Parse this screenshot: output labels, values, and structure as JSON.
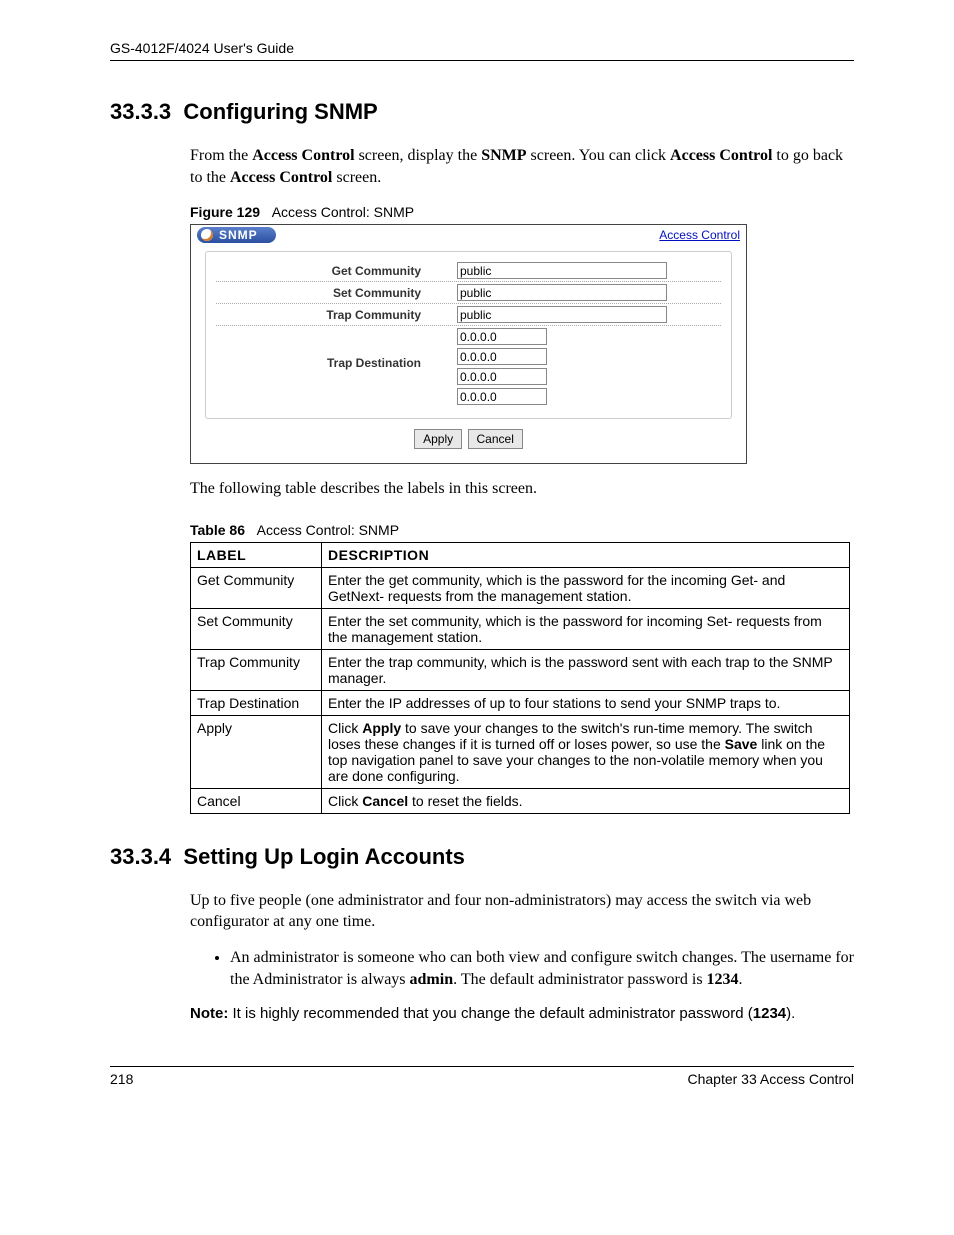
{
  "header": {
    "guide": "GS-4012F/4024 User's Guide"
  },
  "section1": {
    "number": "33.3.3",
    "title": "Configuring SNMP",
    "intro_a": "From the ",
    "intro_b": "Access Control",
    "intro_c": " screen, display the ",
    "intro_d": "SNMP",
    "intro_e": " screen.  You can click ",
    "intro_f": "Access Control",
    "intro_g": " to go back to the ",
    "intro_h": "Access Control",
    "intro_i": " screen."
  },
  "figure": {
    "label": "Figure 129",
    "caption": "Access Control: SNMP",
    "tab": "SNMP",
    "link": "Access Control",
    "rows": {
      "get": {
        "label": "Get Community",
        "value": "public"
      },
      "set": {
        "label": "Set Community",
        "value": "public"
      },
      "trap": {
        "label": "Trap Community",
        "value": "public"
      },
      "dest": {
        "label": "Trap Destination",
        "v1": "0.0.0.0",
        "v2": "0.0.0.0",
        "v3": "0.0.0.0",
        "v4": "0.0.0.0"
      }
    },
    "buttons": {
      "apply": "Apply",
      "cancel": "Cancel"
    }
  },
  "after_figure": "The following table describes the labels in this screen.",
  "table_caption": {
    "label": "Table 86",
    "text": "Access Control: SNMP"
  },
  "table": {
    "head": {
      "c1": "LABEL",
      "c2": "DESCRIPTION"
    },
    "rows": [
      {
        "label": "Get Community",
        "desc": "Enter the get community, which is the password for the incoming Get- and GetNext- requests from the management station."
      },
      {
        "label": "Set Community",
        "desc": "Enter the set community, which is the password for incoming Set- requests from the management station."
      },
      {
        "label": "Trap Community",
        "desc": "Enter the trap community, which is the password sent with each trap to the SNMP manager."
      },
      {
        "label": "Trap Destination",
        "desc": "Enter the IP addresses of up to four stations to send your SNMP traps to."
      }
    ],
    "apply": {
      "label": "Apply",
      "p1": "Click ",
      "b1": "Apply",
      "p2": " to save your changes to the switch's run-time memory. The switch loses these changes if it is turned off or loses power, so use the ",
      "b2": "Save",
      "p3": " link on the top navigation panel to save your changes to the non-volatile memory when you are done configuring."
    },
    "cancel": {
      "label": "Cancel",
      "p1": "Click ",
      "b1": "Cancel",
      "p2": " to reset the fields."
    }
  },
  "section2": {
    "number": "33.3.4",
    "title": "Setting Up Login Accounts",
    "intro": "Up to five people (one administrator and four non-administrators) may access the switch via web configurator at any one time.",
    "bullet_a": "An administrator is someone who can both view and configure switch changes. The username for the Administrator is always ",
    "bullet_b": "admin",
    "bullet_c": ". The default administrator password is ",
    "bullet_d": "1234",
    "bullet_e": ".",
    "note_label": "Note:",
    "note_a": " It is highly recommended that you change the default administrator password (",
    "note_b": "1234",
    "note_c": ")."
  },
  "footer": {
    "page": "218",
    "chapter": "Chapter 33 Access Control"
  }
}
